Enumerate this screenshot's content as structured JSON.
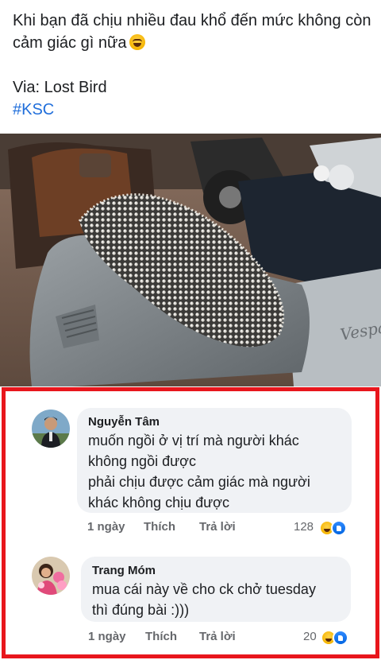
{
  "post": {
    "caption": "Khi bạn đã chịu nhiều đau khổ đến mức không còn cảm giác gì nữa",
    "via": "Via: Lost Bird",
    "hashtag": "#KSC"
  },
  "comments": [
    {
      "author": "Nguyễn Tâm",
      "lines": [
        "muốn ngồi ở vị trí mà người khác",
        "không ngồi được",
        "phải chịu  được cảm giác mà người",
        "khác không chịu được"
      ],
      "time": "1 ngày",
      "like_label": "Thích",
      "reply_label": "Trả lời",
      "reaction_count": "128",
      "reaction_icons": [
        "haha-icon",
        "like-icon"
      ]
    },
    {
      "author": "Trang Móm",
      "lines": [
        "mua cái này về cho ck chở tuesday",
        "thì đúng bài :)))"
      ],
      "time": "1 ngày",
      "like_label": "Thích",
      "reply_label": "Trả lời",
      "reaction_count": "20",
      "reaction_icons": [
        "haha-icon",
        "like-icon"
      ]
    }
  ],
  "colors": {
    "highlight_border": "#e8161c",
    "hashtag": "#216fdb",
    "bubble": "#f0f2f5",
    "meta_text": "#65676b"
  }
}
